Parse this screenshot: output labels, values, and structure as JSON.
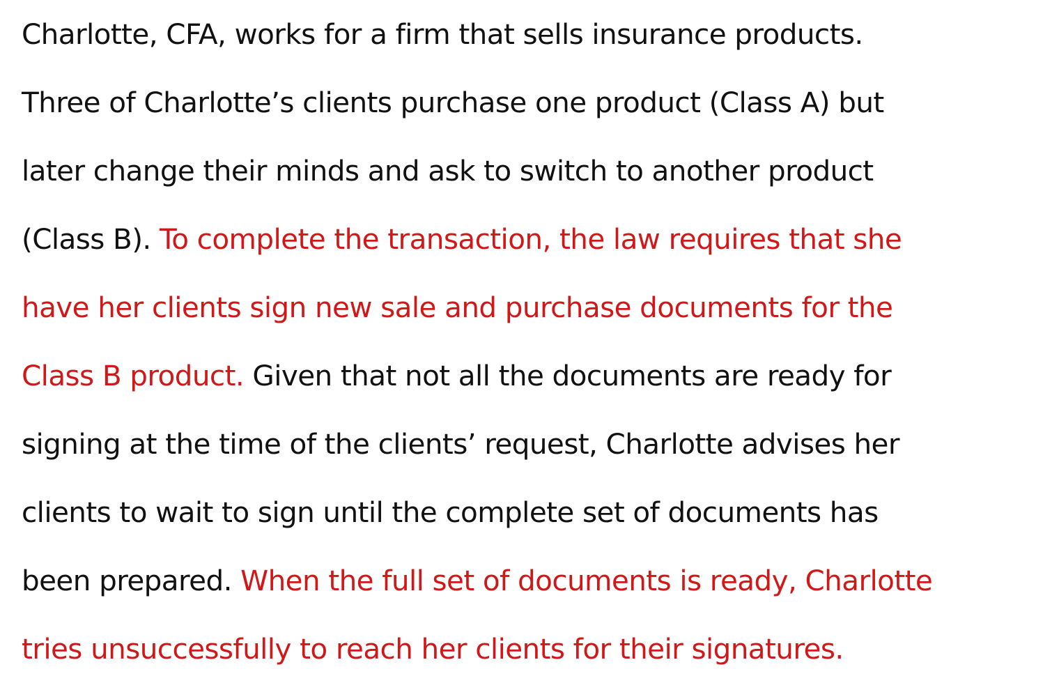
{
  "document": {
    "lines": [
      [
        {
          "text": "Charlotte, CFA, works for a firm that sells insurance products.",
          "highlight": false
        }
      ],
      [
        {
          "text": "Three of Charlotte’s clients purchase one product (Class A) but",
          "highlight": false
        }
      ],
      [
        {
          "text": "later change their minds and ask to switch to another product",
          "highlight": false
        }
      ],
      [
        {
          "text": "(Class B). ",
          "highlight": false
        },
        {
          "text": "To complete the transaction, the law requires that she",
          "highlight": true
        }
      ],
      [
        {
          "text": "have her clients sign new sale and purchase documents for the",
          "highlight": true
        }
      ],
      [
        {
          "text": "Class B product.",
          "highlight": true
        },
        {
          "text": " Given that not all the documents are ready for",
          "highlight": false
        }
      ],
      [
        {
          "text": "signing at the time of the clients’ request, Charlotte advises her",
          "highlight": false
        }
      ],
      [
        {
          "text": "clients to wait to sign until the complete set of documents has",
          "highlight": false
        }
      ],
      [
        {
          "text": "been prepared. ",
          "highlight": false
        },
        {
          "text": "When the full set of documents is ready, Charlotte",
          "highlight": true
        }
      ],
      [
        {
          "text": "tries unsuccessfully to reach her clients for their signatures.",
          "highlight": true
        }
      ]
    ]
  },
  "colors": {
    "text": "#111111",
    "highlight": "#d01818",
    "background": "#ffffff"
  }
}
